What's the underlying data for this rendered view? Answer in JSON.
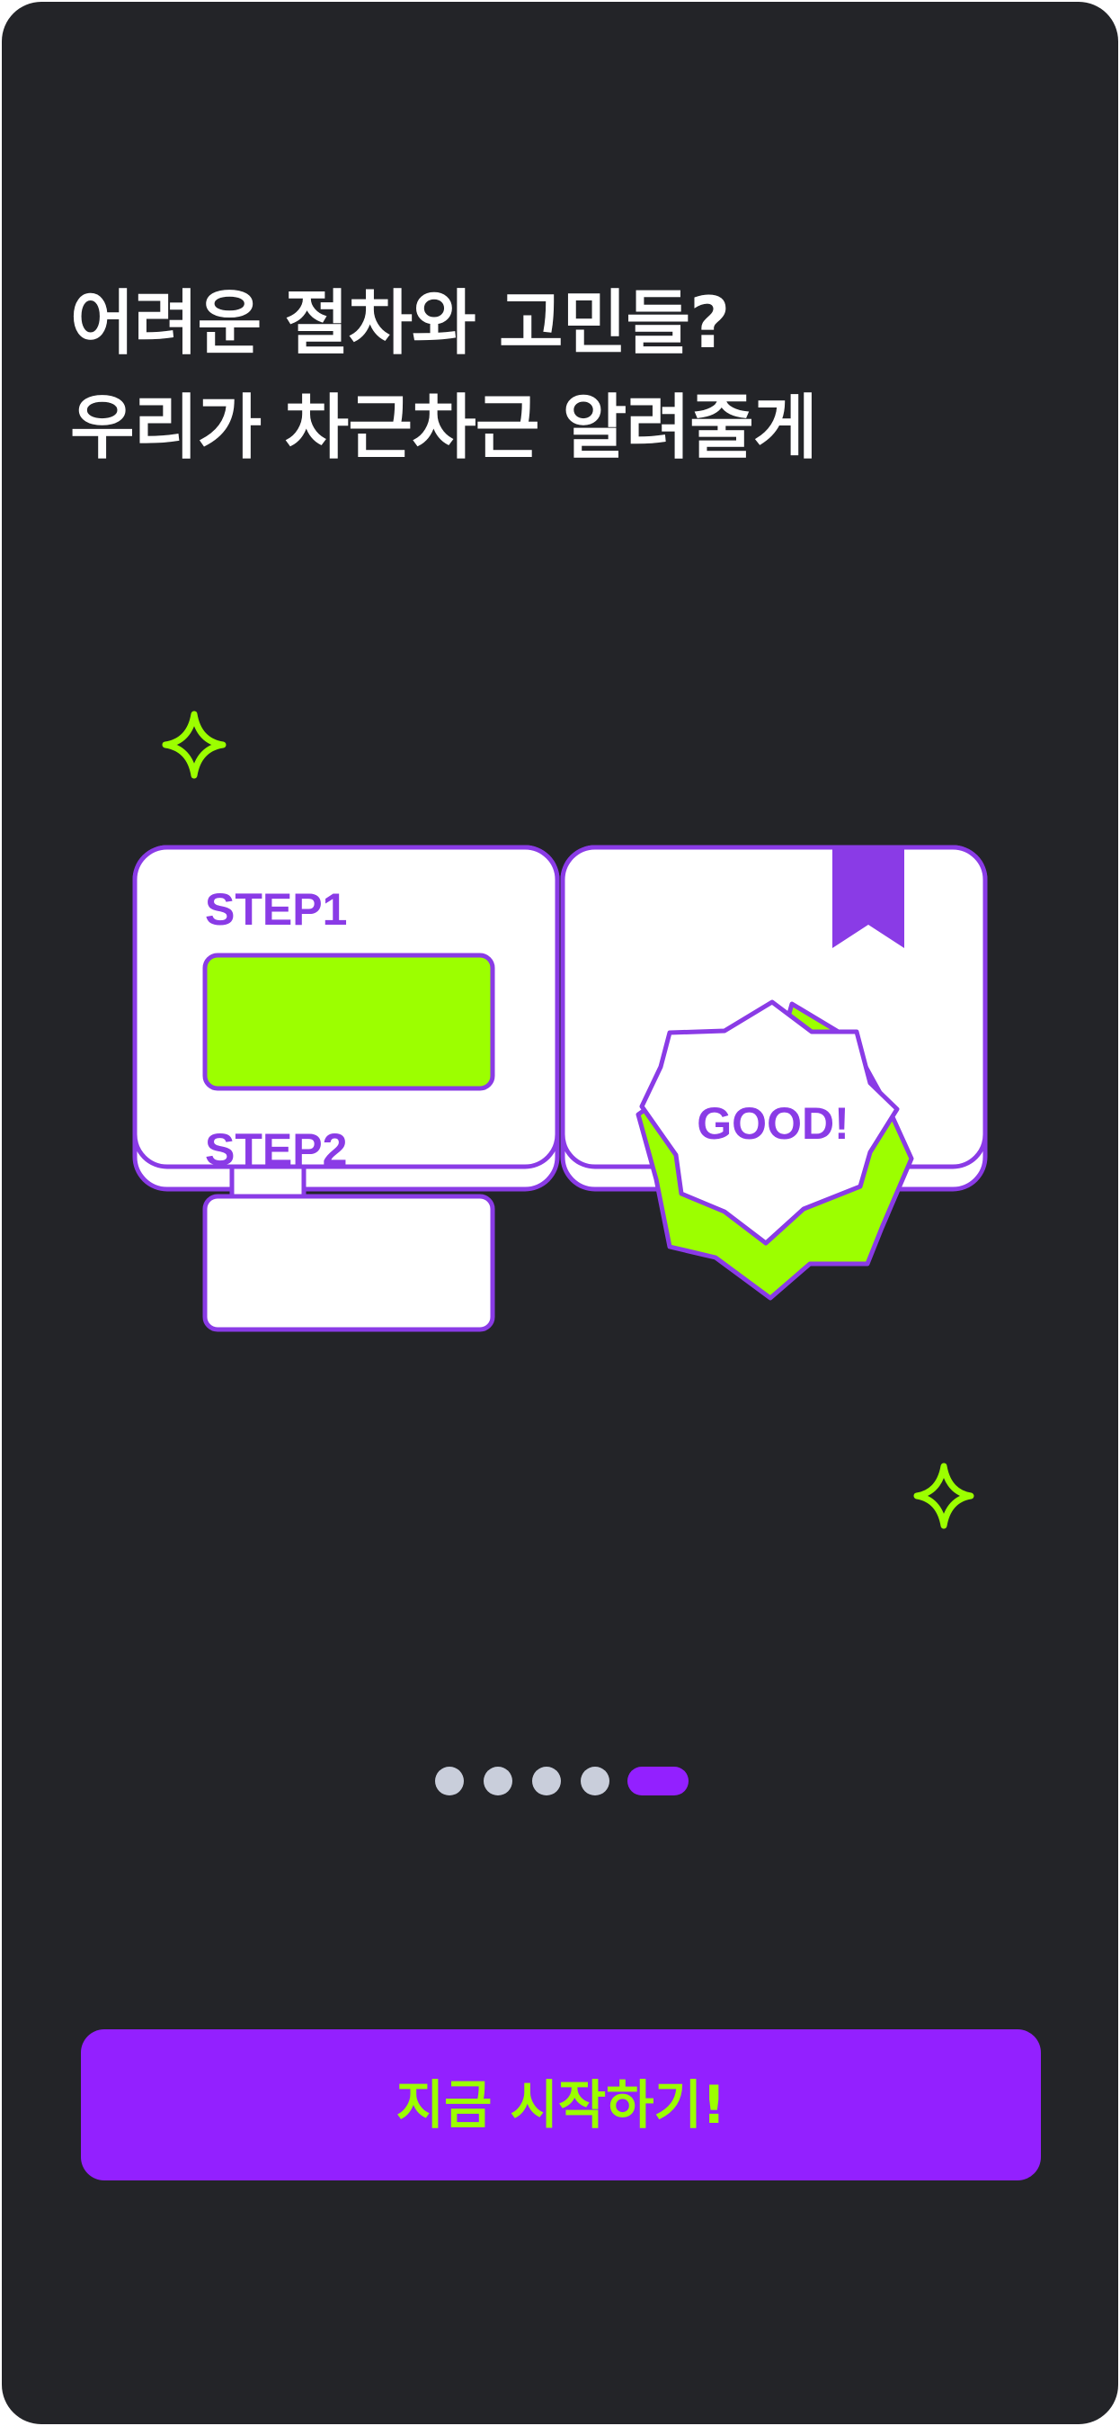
{
  "headline": {
    "line1": "어려운 절차와 고민들?",
    "line2": "우리가 차근차근 알려줄게"
  },
  "illustration": {
    "step1_label": "STEP1",
    "step2_label": "STEP2",
    "badge_text": "GOOD!",
    "icons": [
      "sparkle-icon",
      "bookmark-icon",
      "ribbon-icon",
      "badge-icon"
    ]
  },
  "pagination": {
    "total": 5,
    "active_index": 4
  },
  "cta": {
    "label": "지금 시작하기!"
  },
  "colors": {
    "background": "#232428",
    "accent_purple": "#9320ff",
    "accent_green": "#9cff00",
    "outline_purple": "#8a3be6",
    "dot_inactive": "#c9cedb",
    "page_white": "#ffffff"
  }
}
